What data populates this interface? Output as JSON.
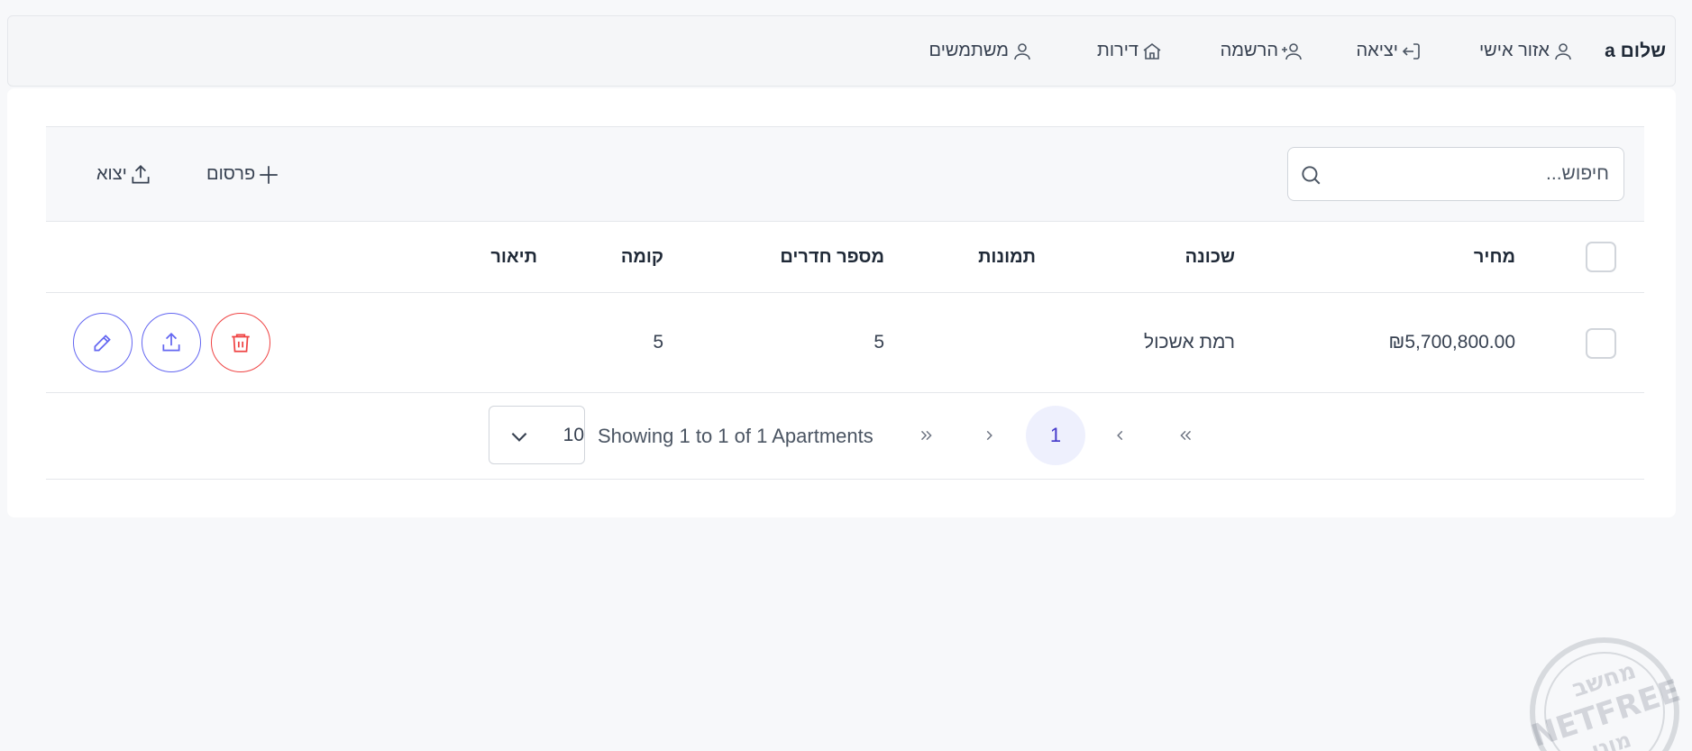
{
  "nav": {
    "greeting": "שלום a",
    "items": [
      {
        "label": "אזור אישי",
        "icon": "user-icon"
      },
      {
        "label": "יציאה",
        "icon": "logout-icon"
      },
      {
        "label": "הרשמה",
        "icon": "user-plus-icon"
      },
      {
        "label": "דירות",
        "icon": "home-icon"
      },
      {
        "label": "משתמשים",
        "icon": "user-icon"
      }
    ]
  },
  "toolbar": {
    "search_placeholder": "חיפוש...",
    "add_label": "פרסום",
    "export_label": "יצוא"
  },
  "table": {
    "headers": {
      "price": "מחיר",
      "neighborhood": "שכונה",
      "images": "תמונות",
      "rooms": "מספר חדרים",
      "floor": "קומה",
      "description": "תיאור"
    },
    "rows": [
      {
        "price": "₪5,700,800.00",
        "neighborhood": "רמת אשכול",
        "images": "",
        "rooms": "5",
        "floor": "5",
        "description": ""
      }
    ]
  },
  "pagination": {
    "page_size": "10",
    "showing_text": "Showing 1 to 1 of 1 Apartments",
    "current_page": "1"
  },
  "watermark": {
    "text_top": "מחשב",
    "text_mid": "NETFREE",
    "text_bottom": "מוגן"
  },
  "colors": {
    "accent": "#6366f1",
    "danger": "#ef4444",
    "active_page_bg": "#eef0fd"
  }
}
